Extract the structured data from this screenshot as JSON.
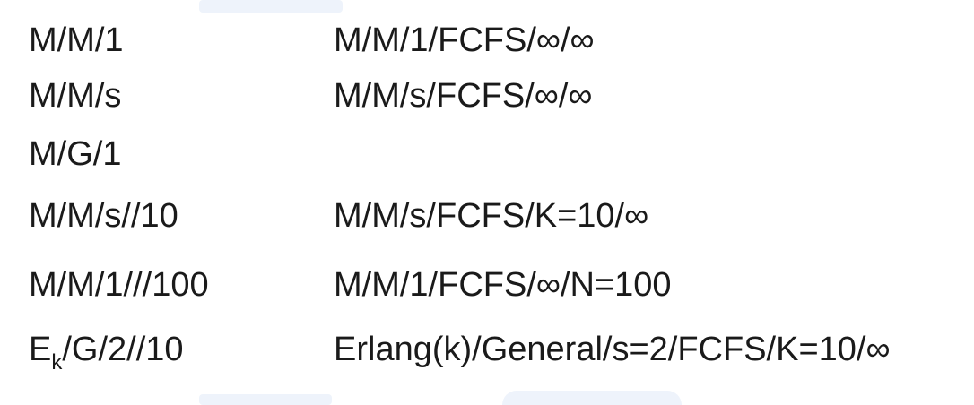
{
  "rows": [
    {
      "abbr": "M/M/1",
      "full": "M/M/1/FCFS/∞/∞"
    },
    {
      "abbr": "M/M/s",
      "full": "M/M/s/FCFS/∞/∞"
    },
    {
      "abbr": "M/G/1",
      "full": ""
    },
    {
      "abbr": "M/M/s//10",
      "full": "M/M/s/FCFS/K=10/∞"
    },
    {
      "abbr": "M/M/1///100",
      "full": "M/M/1/FCFS/∞/N=100"
    },
    {
      "abbr_base": "E",
      "abbr_sub": "k",
      "abbr_rest": "/G/2//10",
      "full": "Erlang(k)/General/s=2/FCFS/K=10/∞"
    }
  ]
}
